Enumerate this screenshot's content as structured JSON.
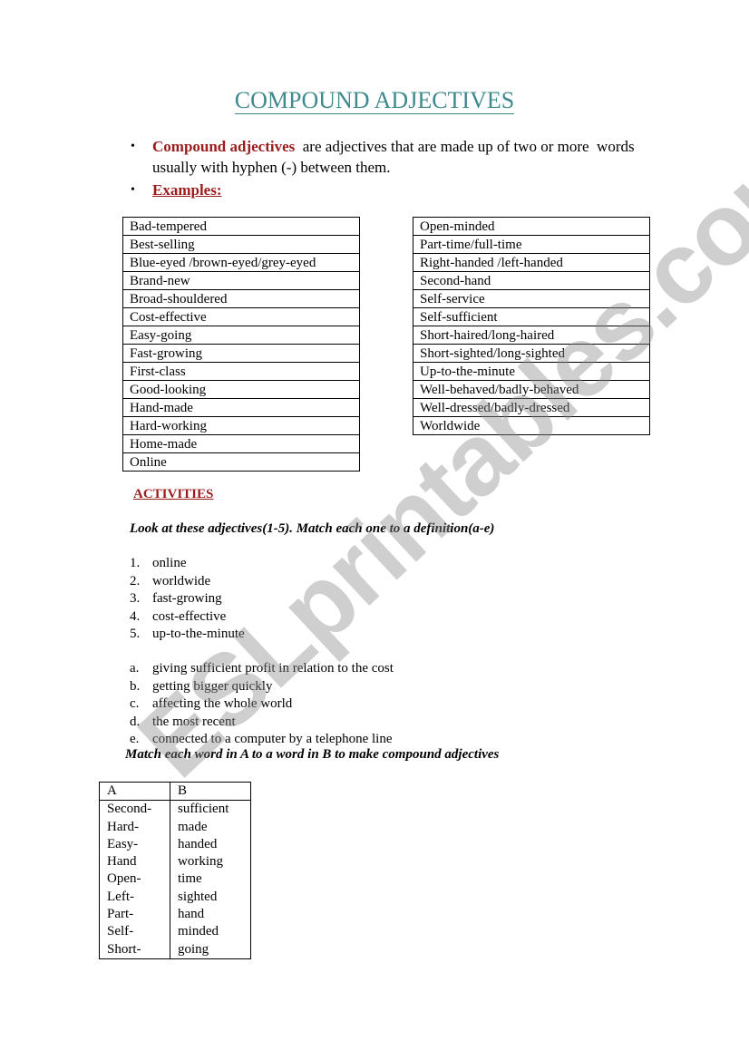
{
  "title": "COMPOUND ADJECTIVES",
  "intro": {
    "bullets": [
      {
        "highlight": "Compound adjectives",
        "text": "  are adjectives that are made up of two or more  words usually with hyphen (-) between them."
      },
      {
        "highlight": "Examples:",
        "text": ""
      }
    ],
    "bullet_glyph": "•"
  },
  "examples": {
    "left": [
      "Bad-tempered",
      "Best-selling",
      "Blue-eyed /brown-eyed/grey-eyed",
      "Brand-new",
      "Broad-shouldered",
      "Cost-effective",
      "Easy-going",
      "Fast-growing",
      "First-class",
      "Good-looking",
      "Hand-made",
      "Hard-working",
      "Home-made",
      "Online"
    ],
    "right": [
      "Open-minded",
      "Part-time/full-time",
      "Right-handed /left-handed",
      "Second-hand",
      "Self-service",
      "Self-sufficient",
      "Short-haired/long-haired",
      "Short-sighted/long-sighted",
      "Up-to-the-minute",
      "Well-behaved/badly-behaved",
      "Well-dressed/badly-dressed",
      "Worldwide"
    ]
  },
  "activities": {
    "heading": "ACTIVITIES",
    "exercise1": {
      "instruction": "Look at these adjectives(1-5). Match each one to a definition(a-e)",
      "items": [
        {
          "marker": "1.",
          "text": "online"
        },
        {
          "marker": "2.",
          "text": "worldwide"
        },
        {
          "marker": "3.",
          "text": "fast-growing"
        },
        {
          "marker": "4.",
          "text": "cost-effective"
        },
        {
          "marker": "5.",
          "text": "up-to-the-minute"
        }
      ],
      "definitions": [
        {
          "marker": "a.",
          "text": "giving sufficient profit in relation to the cost"
        },
        {
          "marker": "b.",
          "text": "getting bigger quickly"
        },
        {
          "marker": "c.",
          "text": "affecting the whole world"
        },
        {
          "marker": "d.",
          "text": "the most recent"
        },
        {
          "marker": "e.",
          "text": "connected to a computer by a telephone line"
        }
      ]
    },
    "exercise2": {
      "instruction": "Match each word in A to a word in B to make compound adjectives",
      "headers": [
        "A",
        "B"
      ],
      "column_a": [
        "Second-",
        "Hard-",
        "Easy-",
        "Hand",
        "Open-",
        "Left-",
        "Part-",
        "Self-",
        "Short-"
      ],
      "column_b": [
        "sufficient",
        "made",
        "handed",
        "working",
        "time",
        "sighted",
        "hand",
        "minded",
        "going"
      ]
    }
  },
  "watermark": "ESLprintables.com",
  "colors": {
    "title": "#3f8a8e",
    "accent_red": "#9b1c1c",
    "watermark": "#8c8c8c"
  }
}
